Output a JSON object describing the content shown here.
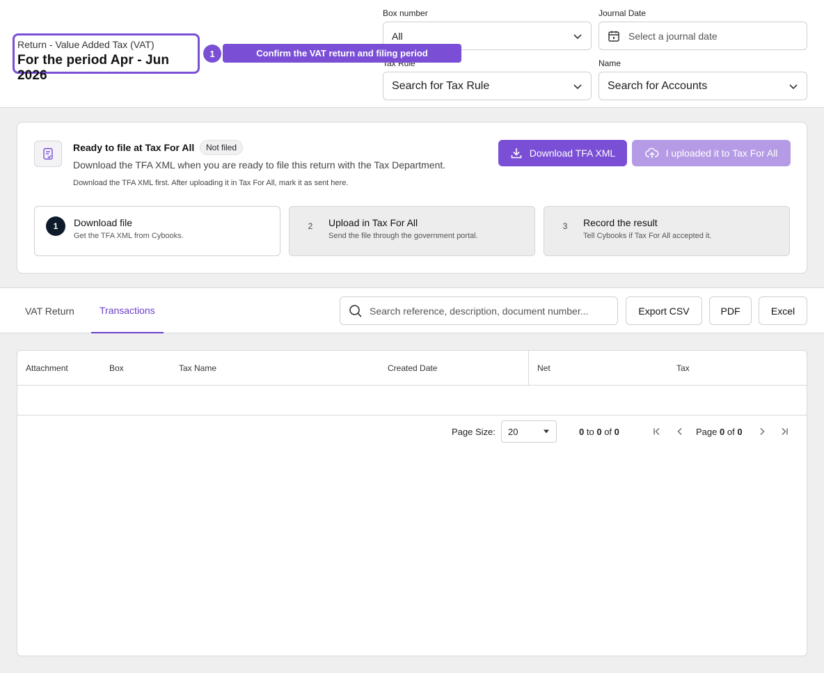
{
  "header": {
    "subtitle": "Return - Value Added Tax (VAT)",
    "title": "For the period Apr - Jun 2026",
    "tour_step": "1",
    "tour_callout": "Confirm the VAT return and filing period"
  },
  "filters": {
    "box_number": {
      "label": "Box number",
      "value": "All"
    },
    "journal_date": {
      "label": "Journal Date",
      "placeholder": "Select a journal date"
    },
    "tax_rule": {
      "label": "Tax Rule",
      "value": "Search for Tax Rule"
    },
    "name": {
      "label": "Name",
      "value": "Search for Accounts"
    }
  },
  "filing": {
    "title": "Ready to file at Tax For All",
    "status": "Not filed",
    "description": "Download the TFA XML when you are ready to file this return with the Tax Department.",
    "hint": "Download the TFA XML first. After uploading it in Tax For All, mark it as sent here.",
    "download_label": "Download TFA XML",
    "uploaded_label": "I uploaded it to Tax For All",
    "steps": [
      {
        "num": "1",
        "title": "Download file",
        "sub": "Get the TFA XML from Cybooks."
      },
      {
        "num": "2",
        "title": "Upload in Tax For All",
        "sub": "Send the file through the government portal."
      },
      {
        "num": "3",
        "title": "Record the result",
        "sub": "Tell Cybooks if Tax For All accepted it."
      }
    ]
  },
  "tabs": [
    {
      "label": "VAT Return"
    },
    {
      "label": "Transactions"
    }
  ],
  "toolbar": {
    "search_placeholder": "Search reference, description, document number...",
    "export_csv": "Export CSV",
    "pdf": "PDF",
    "excel": "Excel"
  },
  "grid": {
    "columns": [
      "Attachment",
      "Box",
      "Tax Name",
      "Created Date",
      "Net",
      "Tax"
    ],
    "page_size_label": "Page Size:",
    "page_size": "20",
    "count": {
      "from": "0",
      "to_word": "to",
      "to": "0",
      "of_word": "of",
      "total": "0"
    },
    "page": {
      "page_word": "Page",
      "current": "0",
      "of_word": "of",
      "total": "0"
    }
  }
}
